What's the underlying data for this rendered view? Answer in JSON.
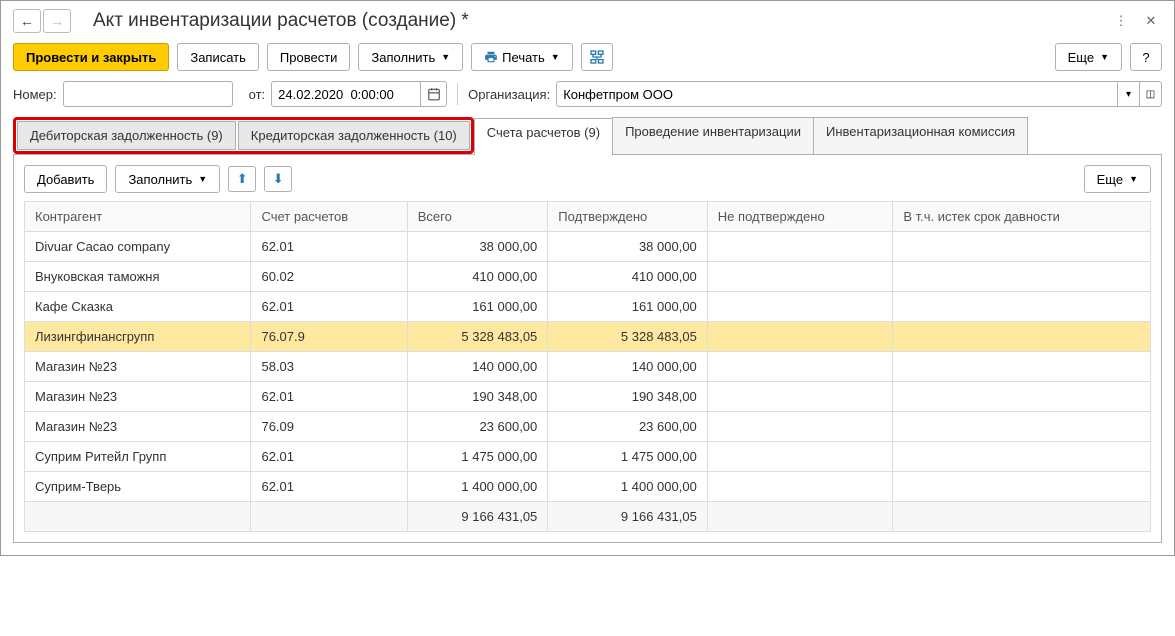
{
  "header": {
    "title": "Акт инвентаризации расчетов (создание) *"
  },
  "toolbar": {
    "post_close": "Провести и закрыть",
    "write": "Записать",
    "post": "Провести",
    "fill": "Заполнить",
    "print": "Печать",
    "more": "Еще",
    "help": "?"
  },
  "form": {
    "number_label": "Номер:",
    "number": "",
    "from_label": "от:",
    "date": "24.02.2020  0:00:00",
    "org_label": "Организация:",
    "org": "Конфетпром ООО"
  },
  "tabs": {
    "debit": "Дебиторская задолженность (9)",
    "credit": "Кредиторская задолженность (10)",
    "accounts": "Счета расчетов (9)",
    "procedure": "Проведение инвентаризации",
    "commission": "Инвентаризационная комиссия"
  },
  "subtoolbar": {
    "add": "Добавить",
    "fill": "Заполнить",
    "more": "Еще"
  },
  "columns": {
    "counterparty": "Контрагент",
    "account": "Счет расчетов",
    "total": "Всего",
    "confirmed": "Подтверждено",
    "unconfirmed": "Не подтверждено",
    "expired": "В т.ч. истек срок давности"
  },
  "rows": [
    {
      "c": "Divuar Cacao company",
      "a": "62.01",
      "t": "38 000,00",
      "p": "38 000,00",
      "n": "",
      "e": ""
    },
    {
      "c": "Внуковская таможня",
      "a": "60.02",
      "t": "410 000,00",
      "p": "410 000,00",
      "n": "",
      "e": ""
    },
    {
      "c": "Кафе Сказка",
      "a": "62.01",
      "t": "161 000,00",
      "p": "161 000,00",
      "n": "",
      "e": ""
    },
    {
      "c": "Лизингфинансгрупп",
      "a": "76.07.9",
      "t": "5 328 483,05",
      "p": "5 328 483,05",
      "n": "",
      "e": "",
      "sel": true
    },
    {
      "c": "Магазин №23",
      "a": "58.03",
      "t": "140 000,00",
      "p": "140 000,00",
      "n": "",
      "e": ""
    },
    {
      "c": "Магазин №23",
      "a": "62.01",
      "t": "190 348,00",
      "p": "190 348,00",
      "n": "",
      "e": ""
    },
    {
      "c": "Магазин №23",
      "a": "76.09",
      "t": "23 600,00",
      "p": "23 600,00",
      "n": "",
      "e": ""
    },
    {
      "c": "Суприм Ритейл Групп",
      "a": "62.01",
      "t": "1 475 000,00",
      "p": "1 475 000,00",
      "n": "",
      "e": ""
    },
    {
      "c": "Суприм-Тверь",
      "a": "62.01",
      "t": "1 400 000,00",
      "p": "1 400 000,00",
      "n": "",
      "e": ""
    }
  ],
  "totals": {
    "t": "9 166 431,05",
    "p": "9 166 431,05"
  }
}
